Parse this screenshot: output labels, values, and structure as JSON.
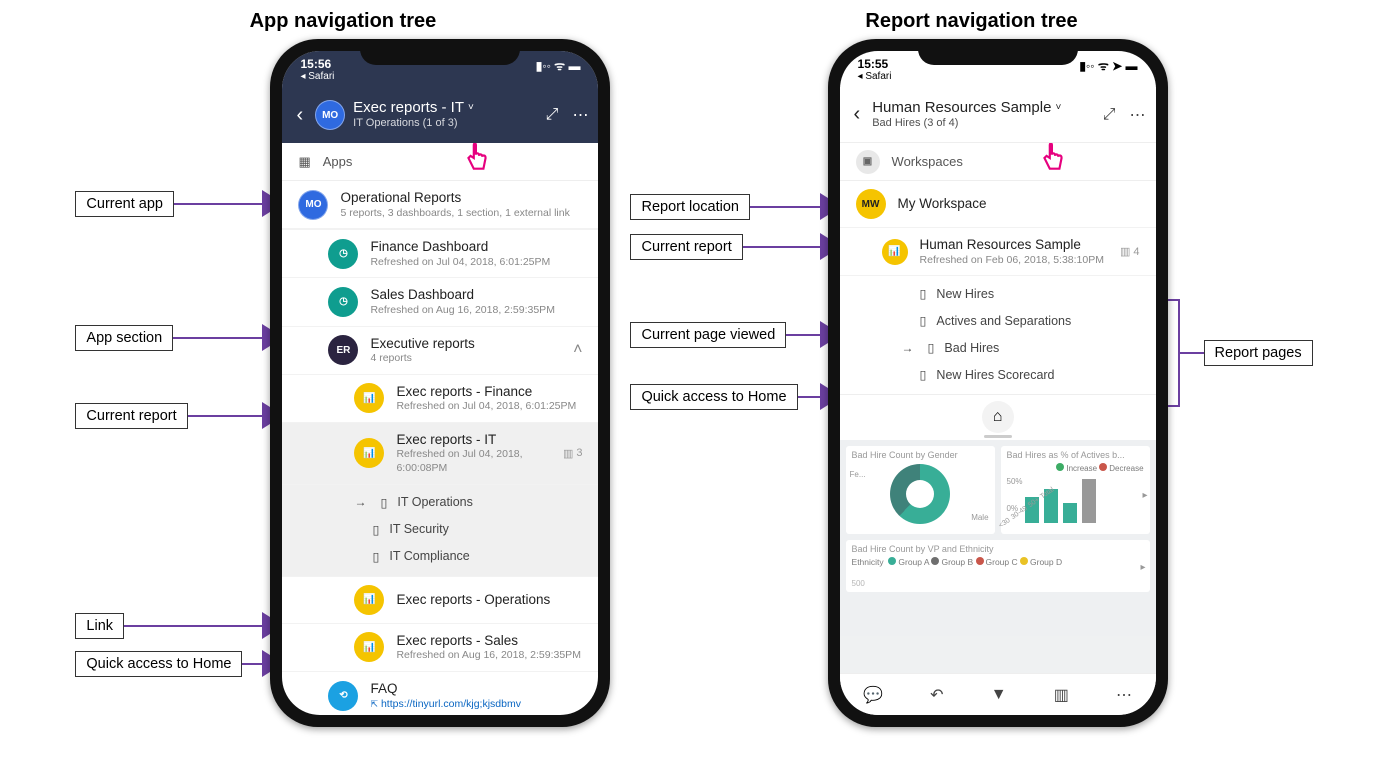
{
  "titles": {
    "left": "App navigation tree",
    "right": "Report navigation tree"
  },
  "callouts": {
    "current_app": "Current app",
    "app_section": "App section",
    "current_report": "Current report",
    "link": "Link",
    "home": "Quick access to Home",
    "report_location": "Report location",
    "current_report2": "Current report",
    "current_page": "Current page viewed",
    "home2": "Quick access to Home",
    "report_pages": "Report pages"
  },
  "phone1": {
    "time": "15:56",
    "safari": "◂ Safari",
    "header": {
      "avatar": "MO",
      "title": "Exec reports - IT",
      "sub": "IT Operations (1 of 3)"
    },
    "apps_label": "Apps",
    "op": {
      "title": "Operational Reports",
      "sub": "5 reports, 3 dashboards, 1 section, 1 external link"
    },
    "finance": {
      "title": "Finance Dashboard",
      "sub": "Refreshed on Jul 04, 2018, 6:01:25PM"
    },
    "sales": {
      "title": "Sales Dashboard",
      "sub": "Refreshed on Aug 16, 2018, 2:59:35PM"
    },
    "exec_section": {
      "title": "Executive reports",
      "sub": "4 reports"
    },
    "r_finance": {
      "title": "Exec reports - Finance",
      "sub": "Refreshed on Jul 04, 2018, 6:01:25PM"
    },
    "r_it": {
      "title": "Exec reports - IT",
      "sub": "Refreshed on Jul 04, 2018, 6:00:08PM",
      "count": "3"
    },
    "pages": {
      "p1": "IT Operations",
      "p2": "IT Security",
      "p3": "IT Compliance"
    },
    "r_ops": {
      "title": "Exec reports - Operations"
    },
    "r_sales": {
      "title": "Exec reports - Sales",
      "sub": "Refreshed on Aug 16, 2018, 2:59:35PM"
    },
    "faq": {
      "title": "FAQ",
      "url": "https://tinyurl.com/kjg;kjsdbmv"
    }
  },
  "phone2": {
    "time": "15:55",
    "safari": "◂ Safari",
    "header": {
      "title": "Human Resources Sample",
      "sub": "Bad Hires (3 of 4)"
    },
    "workspaces_label": "Workspaces",
    "my_workspace": "My Workspace",
    "report": {
      "title": "Human Resources Sample",
      "sub": "Refreshed on Feb 06, 2018, 5:38:10PM",
      "count": "4"
    },
    "pages": {
      "p1": "New Hires",
      "p2": "Actives and Separations",
      "p3": "Bad Hires",
      "p4": "New Hires Scorecard"
    },
    "tiles": {
      "t1": "Bad Hire Count by Gender",
      "t2": "Bad Hires as % of Actives b...",
      "t3": "Bad Hire Count by VP and Ethnicity",
      "legend_inc": "Increase",
      "legend_dec": "Decrease",
      "fe": "Fe...",
      "male": "Male",
      "y50": "50%",
      "y0": "0%",
      "x1": "<30",
      "x2": "30-49",
      "x3": "50+",
      "x4": "Total",
      "eth_lbl": "Ethnicity",
      "ga": "Group A",
      "gb": "Group B",
      "gc": "Group C",
      "gd": "Group D",
      "v500": "500"
    }
  }
}
